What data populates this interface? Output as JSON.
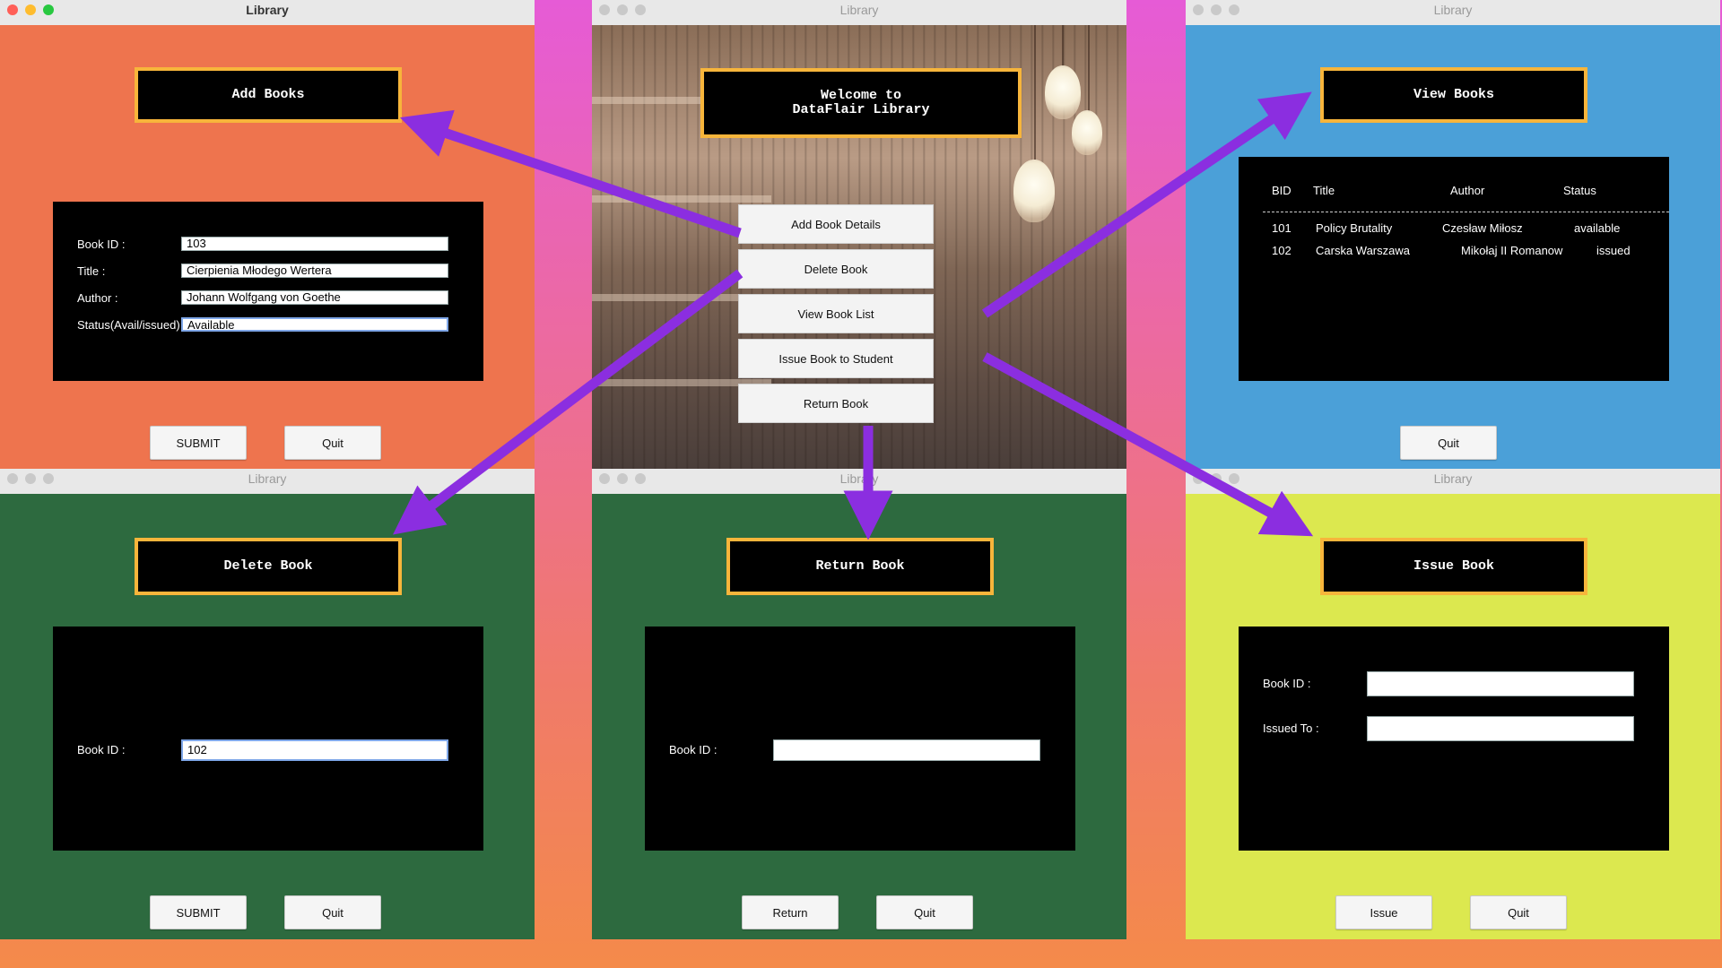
{
  "window_title": "Library",
  "add_books": {
    "heading": "Add Books",
    "labels": [
      "Book ID :",
      "Title :",
      "Author :",
      "Status(Avail/issued)"
    ],
    "values": [
      "103",
      "Cierpienia Młodego Wertera",
      "Johann Wolfgang von Goethe",
      "Available"
    ],
    "submit_label": "SUBMIT",
    "quit_label": "Quit",
    "bg_color": "#ee744e"
  },
  "main_menu": {
    "heading": "Welcome to\nDataFlair Library",
    "buttons": [
      "Add Book Details",
      "Delete Book",
      "View Book List",
      "Issue Book to Student",
      "Return Book"
    ]
  },
  "view_books": {
    "heading": "View Books",
    "columns": [
      "BID",
      "Title",
      "Author",
      "Status"
    ],
    "rows": [
      [
        "101",
        "Policy Brutality",
        "Czesław Miłosz",
        "available"
      ],
      [
        "102",
        "Carska Warszawa",
        "Mikołaj II Romanow",
        "issued"
      ]
    ],
    "quit_label": "Quit",
    "bg_color": "#4ba0d8"
  },
  "delete_book": {
    "heading": "Delete Book",
    "label": "Book ID :",
    "value": "102",
    "submit_label": "SUBMIT",
    "quit_label": "Quit",
    "bg_color": "#2d6a3f"
  },
  "return_book": {
    "heading": "Return Book",
    "label": "Book ID :",
    "value": "",
    "return_label": "Return",
    "quit_label": "Quit",
    "bg_color": "#2d6a3f"
  },
  "issue_book": {
    "heading": "Issue Book",
    "labels": [
      "Book ID :",
      "Issued To :"
    ],
    "values": [
      "",
      ""
    ],
    "issue_label": "Issue",
    "quit_label": "Quit",
    "bg_color": "#dce84f"
  },
  "colors": {
    "heading_border": "#f7b53b",
    "arrow": "#8b2ee0"
  }
}
